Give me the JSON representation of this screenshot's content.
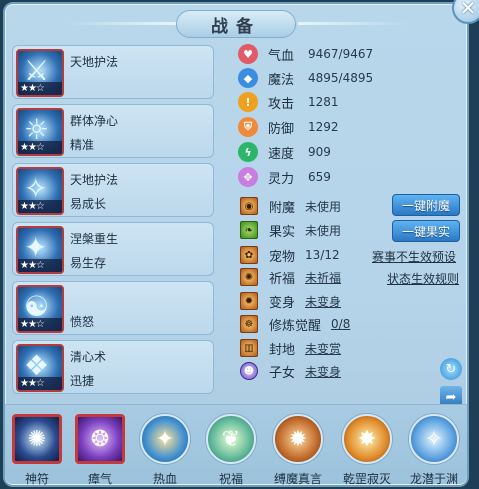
{
  "title": "战备",
  "close_glyph": "✕",
  "skills": [
    {
      "name": "天地护法",
      "sub": "",
      "stars": "★★☆"
    },
    {
      "name": "群体净心",
      "sub": "精准",
      "stars": "★★☆"
    },
    {
      "name": "天地护法",
      "sub": "易成长",
      "stars": "★★☆"
    },
    {
      "name": "涅槃重生",
      "sub": "易生存",
      "stars": "★★☆"
    },
    {
      "name": "",
      "sub": "愤怒",
      "stars": "★★☆"
    },
    {
      "name": "清心术",
      "sub": "迅捷",
      "stars": "★★☆"
    }
  ],
  "stats": [
    {
      "label": "气血",
      "value": "9467/9467",
      "icon": "heart-icon",
      "color": "#e05a68"
    },
    {
      "label": "魔法",
      "value": "4895/4895",
      "icon": "mana-icon",
      "color": "#3a8de0"
    },
    {
      "label": "攻击",
      "value": "1281",
      "icon": "attack-icon",
      "color": "#f0a020"
    },
    {
      "label": "防御",
      "value": "1292",
      "icon": "shield-icon",
      "color": "#f08a3a"
    },
    {
      "label": "速度",
      "value": "909",
      "icon": "speed-icon",
      "color": "#2bb66a"
    },
    {
      "label": "灵力",
      "value": "659",
      "icon": "spirit-icon",
      "color": "#c77ee0"
    }
  ],
  "extras": [
    {
      "label": "附魔",
      "value": "未使用"
    },
    {
      "label": "果实",
      "value": "未使用"
    },
    {
      "label": "宠物",
      "value": "13/12"
    },
    {
      "label": "祈福",
      "value": "未祈福"
    },
    {
      "label": "变身",
      "value": "未变身"
    },
    {
      "label": "修炼觉醒",
      "value": "0/8"
    },
    {
      "label": "封地",
      "value": "未变赏"
    },
    {
      "label": "子女",
      "value": "未变身"
    }
  ],
  "buttons": {
    "enchant_all": "一键附魔",
    "fruit_all": "一键果实"
  },
  "links": {
    "preset": "赛事不生效预设",
    "rules": "状态生效规则"
  },
  "bottom": [
    {
      "label": "神符",
      "glyph": "✺",
      "bg": "#2b4a8f"
    },
    {
      "label": "瘴气",
      "glyph": "❂",
      "bg": "#7a3fbf"
    },
    {
      "label": "热血",
      "glyph": "✦",
      "bg": "#3f8fd0"
    },
    {
      "label": "祝福",
      "glyph": "❦",
      "bg": "#5fb89a"
    },
    {
      "label": "缚魔真言",
      "glyph": "✹",
      "bg": "#c06a2a"
    },
    {
      "label": "乾罡寂灭",
      "glyph": "✸",
      "bg": "#e08a2a"
    },
    {
      "label": "龙潜于渊",
      "glyph": "✧",
      "bg": "#5aa0e0"
    }
  ]
}
